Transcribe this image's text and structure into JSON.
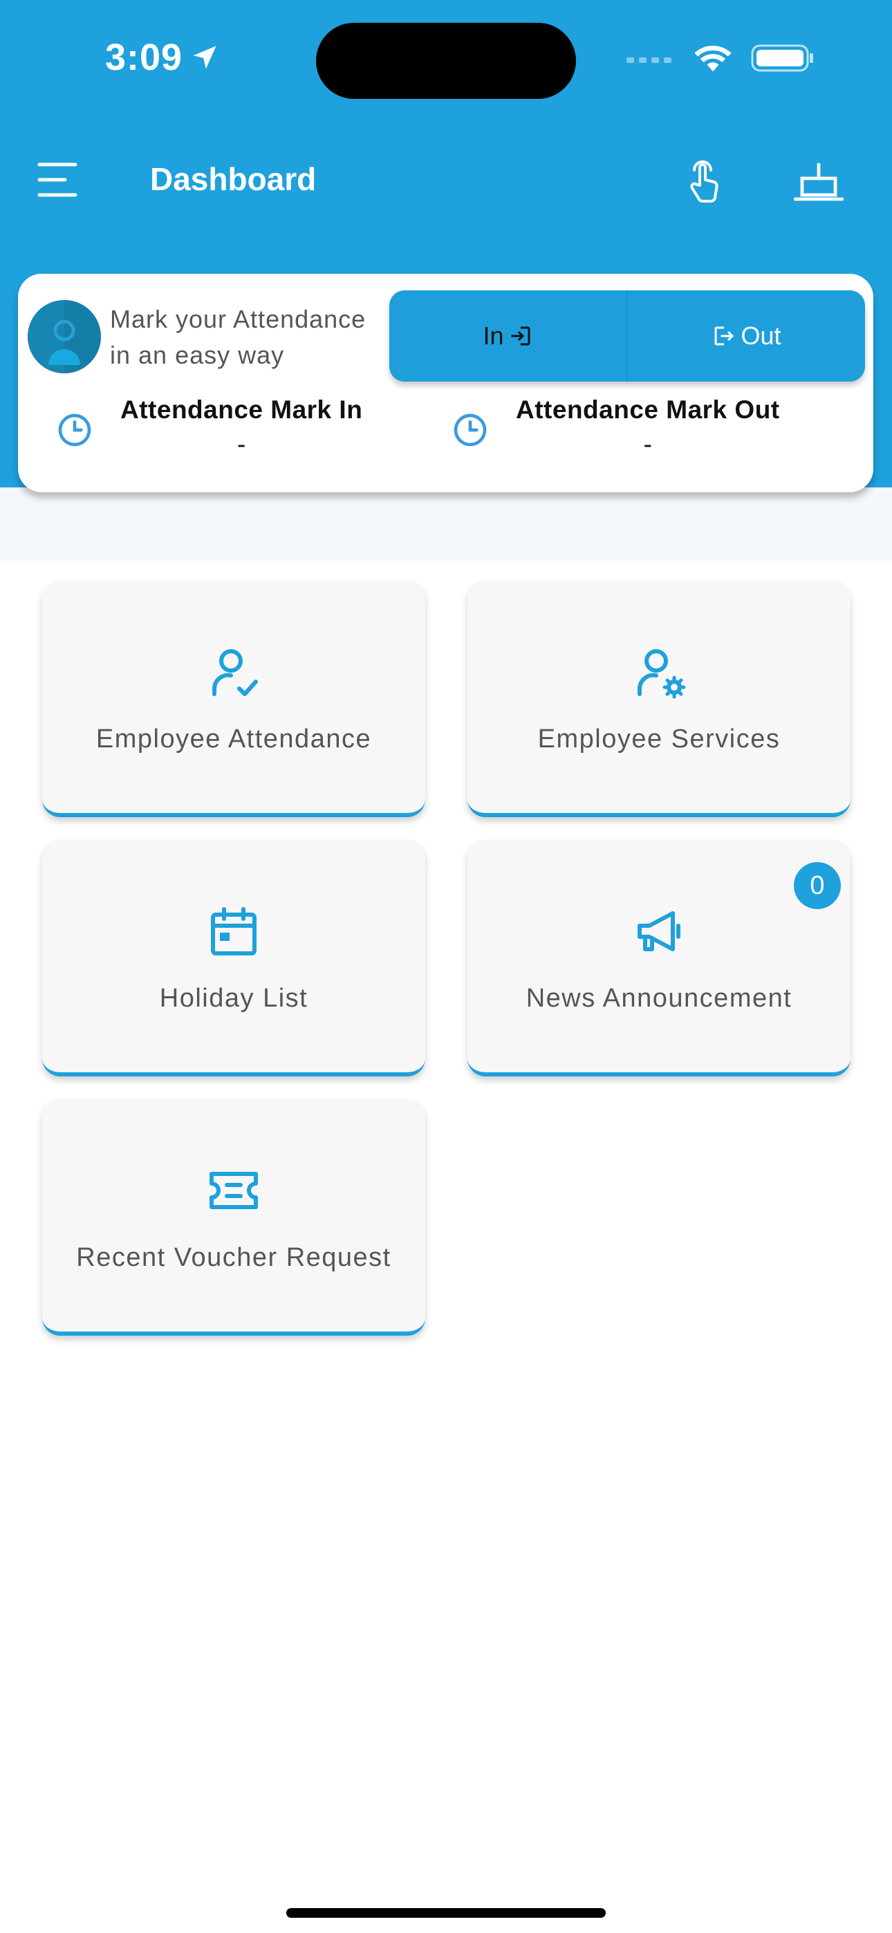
{
  "status_bar": {
    "time": "3:09"
  },
  "header": {
    "title": "Dashboard",
    "icons": [
      "menu-icon",
      "hand-tap-icon",
      "table-lamp-icon"
    ]
  },
  "attendance": {
    "prompt_line1": "Mark your Attendance",
    "prompt_line2": "in an easy way",
    "in_label": "In",
    "out_label": "Out",
    "mark_in_title": "Attendance Mark In",
    "mark_in_value": "-",
    "mark_out_title": "Attendance Mark Out",
    "mark_out_value": "-"
  },
  "tiles": [
    {
      "label": "Employee Attendance",
      "icon": "user-check-icon"
    },
    {
      "label": "Employee Services",
      "icon": "user-gear-icon"
    },
    {
      "label": "Holiday List",
      "icon": "calendar-icon"
    },
    {
      "label": "News Announcement",
      "icon": "megaphone-icon",
      "badge": "0"
    },
    {
      "label": "Recent Voucher Request",
      "icon": "ticket-icon"
    }
  ],
  "colors": {
    "primary": "#1ea1dc",
    "tile_bg": "#f7f7f7",
    "band": "#f4f7fb"
  }
}
